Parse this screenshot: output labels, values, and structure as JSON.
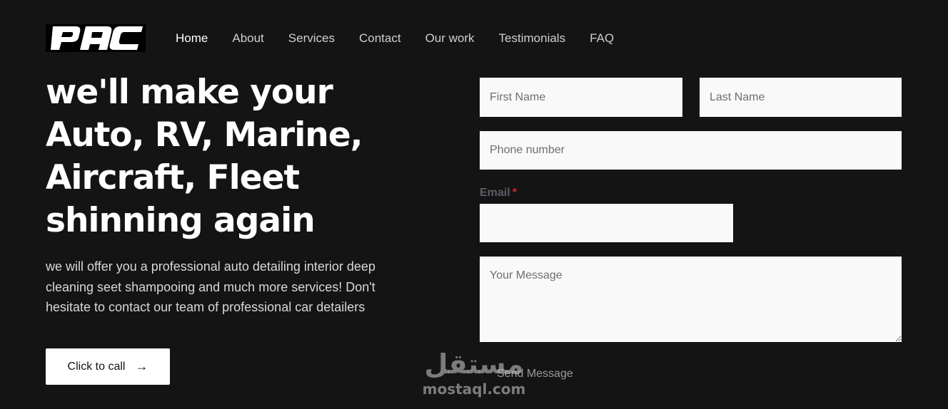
{
  "brand": {
    "logo_text": "PAC"
  },
  "nav": {
    "items": [
      {
        "label": "Home",
        "active": true
      },
      {
        "label": "About"
      },
      {
        "label": "Services"
      },
      {
        "label": "Contact"
      },
      {
        "label": "Our work"
      },
      {
        "label": "Testimonials"
      },
      {
        "label": "FAQ"
      }
    ]
  },
  "hero": {
    "title_lines": [
      "we'll make your",
      "Auto, RV, Marine,",
      "Aircraft, Fleet",
      "shinning again"
    ],
    "description": "we will offer you a professional auto detailing interior deep cleaning seet shampooing and much more services! Don't hesitate to contact our team of professional car detailers",
    "call_button_label": "Click to call",
    "call_button_icon": "arrow-right-icon"
  },
  "form": {
    "first_name_placeholder": "First Name",
    "last_name_placeholder": "Last Name",
    "phone_placeholder": "Phone number",
    "email_label": "Email",
    "email_required_mark": "*",
    "message_placeholder": "Your Message",
    "submit_label": "Send Message"
  },
  "watermark": {
    "arabic": "مستقل",
    "latin": "mostaql.com"
  },
  "colors": {
    "background": "#141414",
    "field": "#f9f9f9",
    "required": "#d0232b",
    "button": "#ffffff"
  }
}
